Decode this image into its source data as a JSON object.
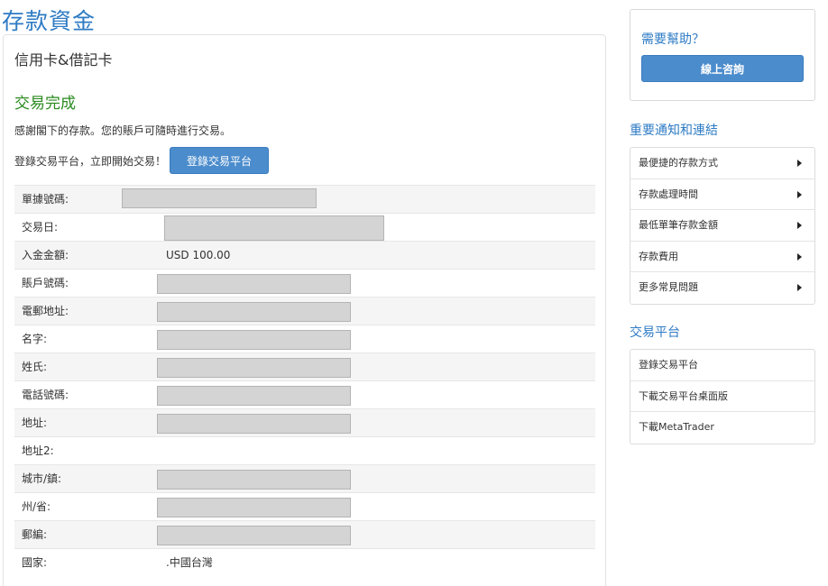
{
  "page_title": "存款資金",
  "card": {
    "title": "信用卡&借記卡",
    "success_heading": "交易完成",
    "thanks_text": "感謝閣下的存款。您的賬戶可隨時進行交易。",
    "login_prompt": "登錄交易平台，立即開始交易！",
    "login_button": "登錄交易平台"
  },
  "details": [
    {
      "label": "單據號碼:",
      "value": ""
    },
    {
      "label": "交易日:",
      "value": ""
    },
    {
      "label": "入金金額:",
      "value": "USD 100.00"
    },
    {
      "label": "賬戶號碼:",
      "value": ""
    },
    {
      "label": "電郵地址:",
      "value": ""
    },
    {
      "label": "名字:",
      "value": ""
    },
    {
      "label": "姓氏:",
      "value": ""
    },
    {
      "label": "電話號碼:",
      "value": ""
    },
    {
      "label": "地址:",
      "value": ""
    },
    {
      "label": "地址2:",
      "value": ""
    },
    {
      "label": "城市/鎮:",
      "value": ""
    },
    {
      "label": "州/省:",
      "value": ""
    },
    {
      "label": "郵編:",
      "value": ""
    },
    {
      "label": "國家:",
      "value": ".中國台灣"
    }
  ],
  "help": {
    "title": "需要幫助？",
    "button": "線上咨詢"
  },
  "notices": {
    "title": "重要通知和連結",
    "items": [
      "最便捷的存款方式",
      "存款處理時間",
      "最低單筆存款金額",
      "存款費用",
      "更多常見問題"
    ]
  },
  "platform": {
    "title": "交易平台",
    "items": [
      "登錄交易平台",
      "下載交易平台桌面版",
      "下載MetaTrader"
    ]
  },
  "colors": {
    "accent": "#2e7bc4",
    "button": "#4b8ccc",
    "success": "#2a8a1e",
    "masked": "#d4d4d4"
  }
}
